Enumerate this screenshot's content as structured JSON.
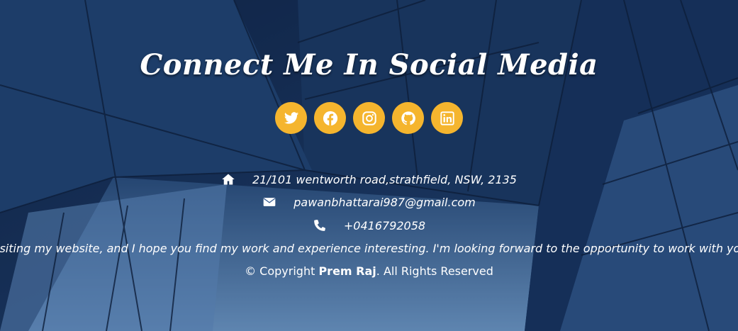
{
  "section": {
    "title": "Connect Me In Social Media"
  },
  "socials": [
    {
      "icon": "twitter-icon"
    },
    {
      "icon": "facebook-icon"
    },
    {
      "icon": "instagram-icon"
    },
    {
      "icon": "github-icon"
    },
    {
      "icon": "linkedin-icon"
    }
  ],
  "contact": {
    "address": "21/101 wentworth road,strathfield, NSW, 2135",
    "email": "pawanbhattarai987@gmail.com",
    "phone": "+0416792058"
  },
  "marquee": {
    "text": "isiting my website, and I hope you find my work and experience interesting. I'm looking forward to the opportunity to work with you on you"
  },
  "footer": {
    "copyright_prefix": "© Copyright ",
    "name": "Prem Raj",
    "copyright_suffix": ". All Rights Reserved"
  },
  "colors": {
    "accent": "#f5b52e",
    "text": "#ffffff",
    "background": "#1f3f6a"
  }
}
